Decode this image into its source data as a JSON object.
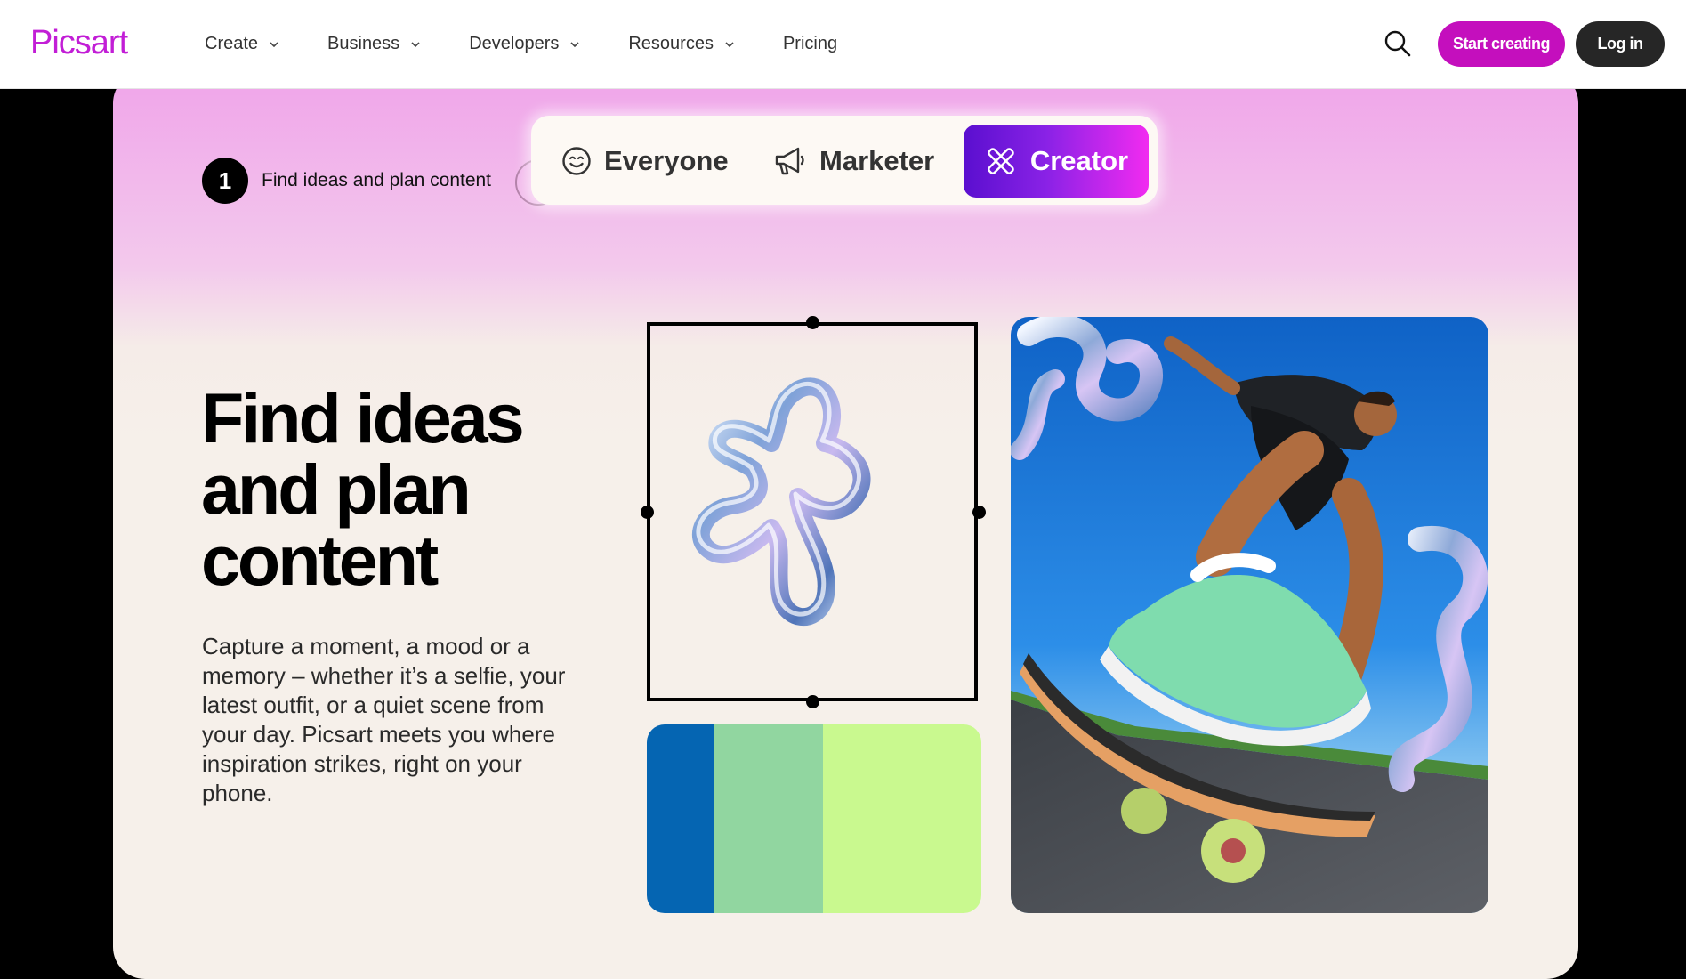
{
  "header": {
    "logo": "Picsart",
    "nav": [
      {
        "label": "Create",
        "has_dropdown": true
      },
      {
        "label": "Business",
        "has_dropdown": true
      },
      {
        "label": "Developers",
        "has_dropdown": true
      },
      {
        "label": "Resources",
        "has_dropdown": true
      },
      {
        "label": "Pricing",
        "has_dropdown": false
      }
    ],
    "search_icon": "search-icon",
    "start_label": "Start creating",
    "login_label": "Log in"
  },
  "colors": {
    "brand": "#c21ed6",
    "start_button": "#c40fbd",
    "login_button": "#262626",
    "creator_gradient": [
      "#5a0fcf",
      "#f12bf0"
    ]
  },
  "step": {
    "number": "1",
    "label": "Find ideas and plan content"
  },
  "audience_tabs": [
    {
      "label": "Everyone",
      "icon": "smile-icon",
      "active": false
    },
    {
      "label": "Marketer",
      "icon": "megaphone-icon",
      "active": false
    },
    {
      "label": "Creator",
      "icon": "tools-icon",
      "active": true
    }
  ],
  "hero": {
    "title_lines": [
      "Find ideas",
      "and plan",
      "content"
    ],
    "description_lines": [
      "Capture a moment, a mood or a",
      "memory – whether it’s a selfie, your",
      "latest outfit, or a quiet scene from",
      "your day. Picsart meets you where",
      "inspiration strikes, right on your",
      "phone."
    ]
  },
  "palette": [
    "#0565b2",
    "#91d6a0",
    "#c9f98f"
  ],
  "photo": {
    "icon": "skateboarder-photo"
  }
}
